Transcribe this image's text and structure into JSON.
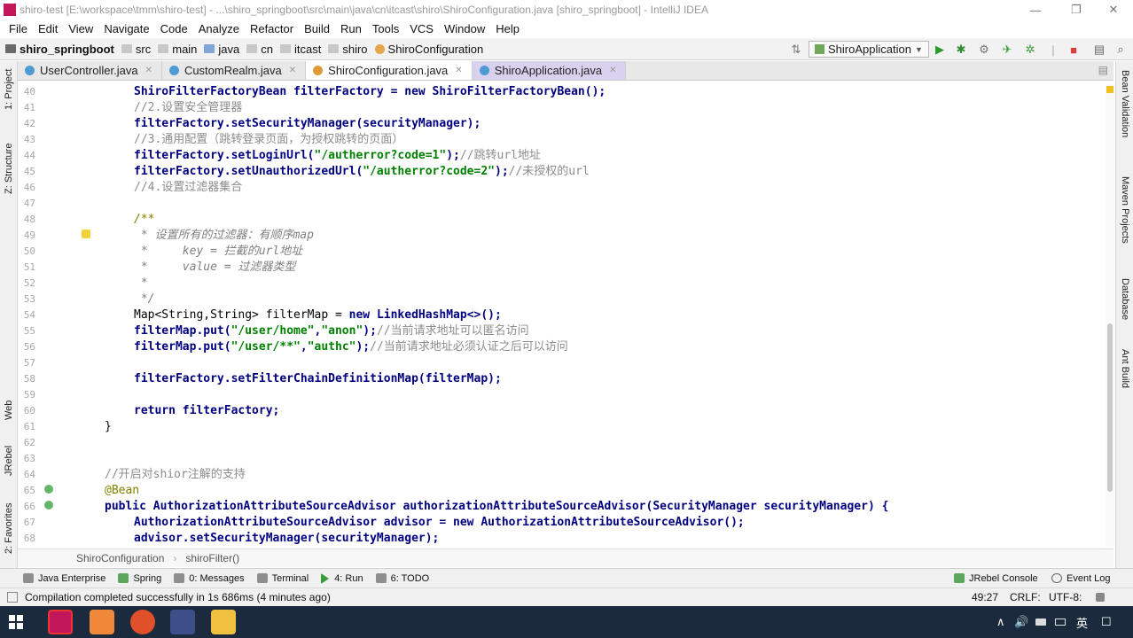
{
  "window": {
    "title": "shiro-test [E:\\workspace\\tmm\\shiro-test] - ...\\shiro_springboot\\src\\main\\java\\cn\\itcast\\shiro\\ShiroConfiguration.java [shiro_springboot] - IntelliJ IDEA",
    "minimize": "—",
    "maximize": "❐",
    "close": "✕"
  },
  "menu": [
    "File",
    "Edit",
    "View",
    "Navigate",
    "Code",
    "Analyze",
    "Refactor",
    "Build",
    "Run",
    "Tools",
    "VCS",
    "Window",
    "Help"
  ],
  "navbar": {
    "crumbs": [
      "shiro_springboot",
      "src",
      "main",
      "java",
      "cn",
      "itcast",
      "shiro",
      "ShiroConfiguration"
    ],
    "run_config": "ShiroApplication"
  },
  "tabs": [
    {
      "label": "UserController.java"
    },
    {
      "label": "CustomRealm.java"
    },
    {
      "label": "ShiroConfiguration.java"
    },
    {
      "label": "ShiroApplication.java"
    }
  ],
  "left_tools": [
    "1: Project",
    "Z: Structure",
    "Web",
    "JRebel",
    "2: Favorites"
  ],
  "right_tools": [
    "Bean Validation",
    "Maven Projects",
    "Database",
    "Ant Build"
  ],
  "editor": {
    "line_numbers": [
      "40",
      "41",
      "42",
      "43",
      "44",
      "45",
      "46",
      "47",
      "48",
      "49",
      "50",
      "51",
      "52",
      "53",
      "54",
      "55",
      "56",
      "57",
      "58",
      "59",
      "60",
      "61",
      "62",
      "63",
      "64",
      "65",
      "66",
      "67",
      "68"
    ],
    "code": {
      "l40": {
        "type": "ShiroFilterFactoryBean",
        "var": " filterFactory = ",
        "kw_new": "new",
        "ctor": " ShiroFilterFactoryBean();"
      },
      "l41": "//2.设置安全管理器",
      "l42": "filterFactory.setSecurityManager(securityManager);",
      "l43": "//3.通用配置（跳转登录页面，为授权跳转的页面）",
      "l44": {
        "call": "filterFactory.setLoginUrl(",
        "str": "\"/autherror?code=1\"",
        "end": ");",
        "cm": "//跳转url地址"
      },
      "l45": {
        "call": "filterFactory.setUnauthorizedUrl(",
        "str": "\"/autherror?code=2\"",
        "end": ");",
        "cm": "//未授权的url"
      },
      "l46": "//4.设置过滤器集合",
      "l48": "/**",
      "l49": " * 设置所有的过滤器：有顺序map",
      "l50": " *     key = 拦截的url地址",
      "l51": " *     value = 过滤器类型",
      "l52": " *",
      "l53": " */",
      "l54": {
        "a": "Map<String,String> filterMap = ",
        "kw_new": "new",
        "b": " LinkedHashMap<>();"
      },
      "l55": {
        "call": "filterMap.put(",
        "s1": "\"/user/home\"",
        "comma": ",",
        "s2": "\"anon\"",
        "end": ");",
        "cm": "//当前请求地址可以匿名访问"
      },
      "l56": {
        "call": "filterMap.put(",
        "s1": "\"/user/**\"",
        "comma": ",",
        "s2": "\"authc\"",
        "end": ");",
        "cm": "//当前请求地址必须认证之后可以访问"
      },
      "l58": "filterFactory.setFilterChainDefinitionMap(filterMap);",
      "l60": {
        "kw": "return",
        "rest": " filterFactory;"
      },
      "l61": "}",
      "l64": "//开启对shior注解的支持",
      "l65": "@Bean",
      "l66": {
        "kw": "public",
        "rest": " AuthorizationAttributeSourceAdvisor authorizationAttributeSourceAdvisor(SecurityManager securityManager) {"
      },
      "l67": {
        "a": "AuthorizationAttributeSourceAdvisor advisor = ",
        "kw_new": "new",
        "b": " AuthorizationAttributeSourceAdvisor();"
      },
      "l68": "advisor.setSecurityManager(securityManager);"
    }
  },
  "editor_breadcrumb": [
    "ShiroConfiguration",
    "shiroFilter()"
  ],
  "toolwindows": [
    {
      "label": "Java Enterprise"
    },
    {
      "label": "Spring"
    },
    {
      "label": "0: Messages"
    },
    {
      "label": "Terminal"
    },
    {
      "label": "4: Run"
    },
    {
      "label": "6: TODO"
    }
  ],
  "toolwindows_right": [
    {
      "label": "JRebel Console"
    },
    {
      "label": "Event Log"
    }
  ],
  "status": {
    "message": "Compilation completed successfully in 1s 686ms (4 minutes ago)",
    "position": "49:27",
    "line_sep": "CRLF:",
    "encoding": "UTF-8:"
  },
  "taskbar": {
    "tray": [
      "∧",
      "🔊",
      "英",
      "☐"
    ]
  }
}
